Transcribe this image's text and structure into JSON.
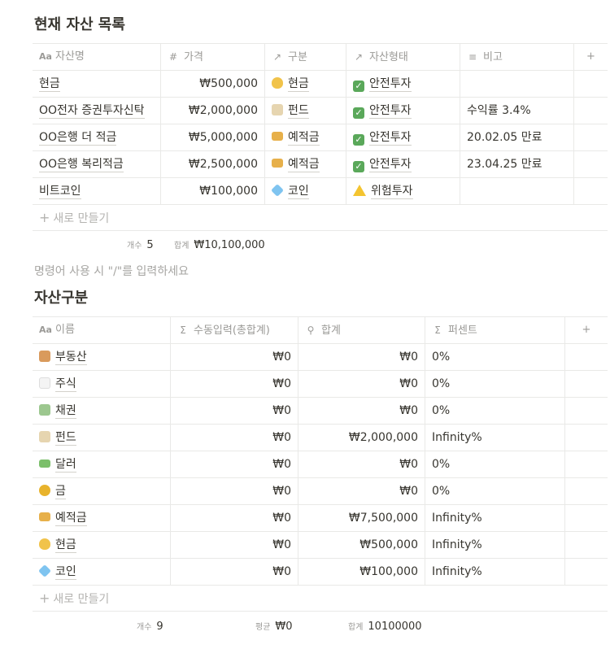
{
  "assets": {
    "title": "현재 자산 목록",
    "headers": {
      "name": "자산명",
      "price": "가격",
      "category": "구분",
      "type": "자산형태",
      "note": "비고"
    },
    "rows": [
      {
        "name": "현금",
        "price": "₩500,000",
        "category": "현금",
        "category_icon": "money-bag-icon",
        "type": "안전투자",
        "type_icon": "check-icon",
        "note": ""
      },
      {
        "name": "OO전자 증권투자신탁",
        "price": "₩2,000,000",
        "category": "펀드",
        "category_icon": "fund-building-icon",
        "type": "안전투자",
        "type_icon": "check-icon",
        "note": "수익률 3.4%"
      },
      {
        "name": "OO은행 더 적금",
        "price": "₩5,000,000",
        "category": "예적금",
        "category_icon": "credit-card-icon",
        "type": "안전투자",
        "type_icon": "check-icon",
        "note": "20.02.05 만료"
      },
      {
        "name": "OO은행 복리적금",
        "price": "₩2,500,000",
        "category": "예적금",
        "category_icon": "credit-card-icon",
        "type": "안전투자",
        "type_icon": "check-icon",
        "note": "23.04.25 만료"
      },
      {
        "name": "비트코인",
        "price": "₩100,000",
        "category": "코인",
        "category_icon": "gem-icon",
        "type": "위험투자",
        "type_icon": "warning-icon",
        "note": ""
      }
    ],
    "new_label": "새로 만들기",
    "summary": {
      "count_key": "개수",
      "count_value": "5",
      "sum_key": "합계",
      "sum_value": "₩10,100,000"
    }
  },
  "command_placeholder": "명령어 사용 시 \"/\"를 입력하세요",
  "categories": {
    "title": "자산구분",
    "headers": {
      "name": "이름",
      "manual": "수동입력(총합계)",
      "total": "합계",
      "percent": "퍼센트"
    },
    "rows": [
      {
        "icon": "house-icon",
        "name": "부동산",
        "manual": "₩0",
        "total": "₩0",
        "percent": "0%"
      },
      {
        "icon": "chart-up-icon",
        "name": "주식",
        "manual": "₩0",
        "total": "₩0",
        "percent": "0%"
      },
      {
        "icon": "bond-icon",
        "name": "채권",
        "manual": "₩0",
        "total": "₩0",
        "percent": "0%"
      },
      {
        "icon": "fund-building-icon",
        "name": "펀드",
        "manual": "₩0",
        "total": "₩2,000,000",
        "percent": "Infinity%"
      },
      {
        "icon": "dollar-bill-icon",
        "name": "달러",
        "manual": "₩0",
        "total": "₩0",
        "percent": "0%"
      },
      {
        "icon": "medal-icon",
        "name": "금",
        "manual": "₩0",
        "total": "₩0",
        "percent": "0%"
      },
      {
        "icon": "credit-card-icon",
        "name": "예적금",
        "manual": "₩0",
        "total": "₩7,500,000",
        "percent": "Infinity%"
      },
      {
        "icon": "money-bag-icon",
        "name": "현금",
        "manual": "₩0",
        "total": "₩500,000",
        "percent": "Infinity%"
      },
      {
        "icon": "gem-icon",
        "name": "코인",
        "manual": "₩0",
        "total": "₩100,000",
        "percent": "Infinity%"
      }
    ],
    "new_label": "새로 만들기",
    "summary": {
      "count_key": "개수",
      "count_value": "9",
      "avg_key": "평균",
      "avg_value": "₩0",
      "sum_key": "합계",
      "sum_value": "10100000"
    }
  }
}
